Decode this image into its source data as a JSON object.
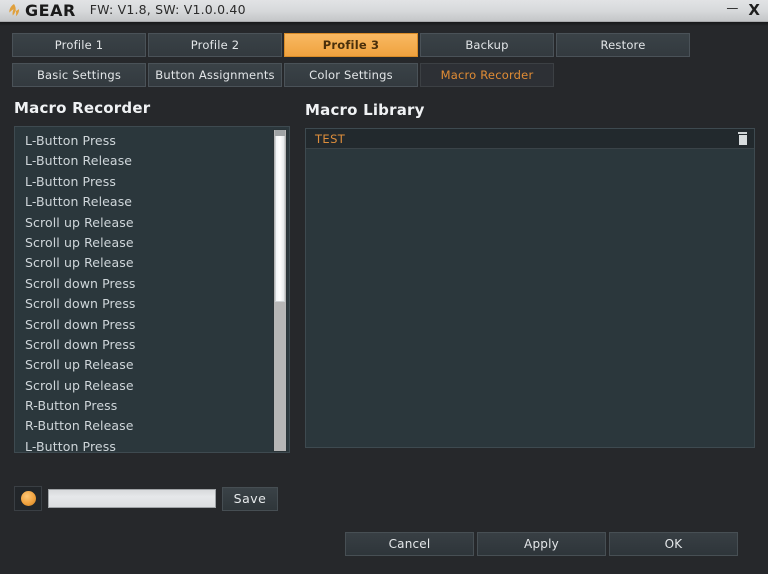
{
  "window": {
    "brand": "GEAR",
    "logo_icon": "fnatic-leaf-logo-icon",
    "firmware_text": "FW: V1.8, SW: V1.0.0.40",
    "minimize_label": "—",
    "close_label": "X"
  },
  "tabs": {
    "profiles": [
      {
        "label": "Profile 1",
        "active": false
      },
      {
        "label": "Profile 2",
        "active": false
      },
      {
        "label": "Profile 3",
        "active": true
      },
      {
        "label": "Backup",
        "active": false
      },
      {
        "label": "Restore",
        "active": false
      }
    ],
    "sections": [
      {
        "label": "Basic Settings",
        "active": false
      },
      {
        "label": "Button Assignments",
        "active": false
      },
      {
        "label": "Color Settings",
        "active": false
      },
      {
        "label": "Macro Recorder",
        "active": true
      }
    ]
  },
  "recorder": {
    "heading": "Macro Recorder",
    "events": [
      "L-Button Press",
      "L-Button Release",
      "L-Button Press",
      "L-Button Release",
      "Scroll up Release",
      "Scroll up Release",
      "Scroll up Release",
      "Scroll down Press",
      "Scroll down Press",
      "Scroll down Press",
      "Scroll down Press",
      "Scroll up Release",
      "Scroll up Release",
      "R-Button Press",
      "R-Button Release",
      "L-Button Press"
    ],
    "scrollbar": {
      "name": "recorder-list-scrollbar"
    }
  },
  "library": {
    "heading": "Macro Library",
    "items": [
      {
        "name": "TEST",
        "delete_icon": "trash-icon"
      }
    ]
  },
  "save": {
    "record_icon": "record-dot-icon",
    "name_value": "",
    "name_placeholder": "",
    "save_label": "Save"
  },
  "actions": {
    "cancel_label": "Cancel",
    "apply_label": "Apply",
    "ok_label": "OK"
  },
  "colors": {
    "accent_orange": "#f0a23f",
    "accent_text_orange": "#de8e3c",
    "panel_bg": "#2b373c",
    "window_bg": "#26282b",
    "titlebar": "#d6d8da"
  }
}
